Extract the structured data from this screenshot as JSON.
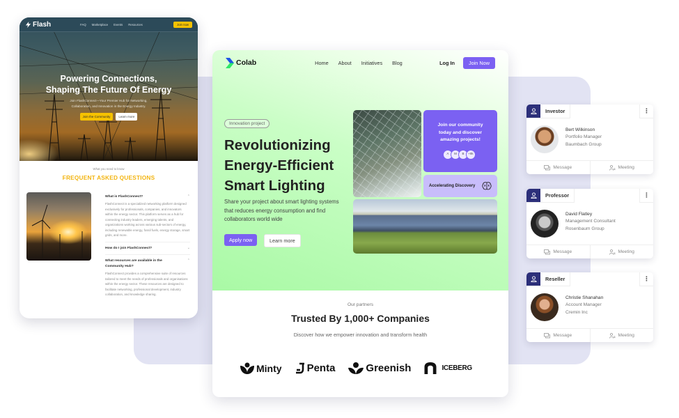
{
  "flash": {
    "brand": "Flash",
    "nav": [
      "FAQ",
      "Marketplace",
      "Events",
      "Resources"
    ],
    "join_label": "Join now",
    "hero_title_line1": "Powering Connections,",
    "hero_title_line2": "Shaping The Future Of Energy",
    "hero_sub_line1": "Join FlashConnect—Your Premier Hub for Networking,",
    "hero_sub_line2": "Collaboration, and Innovation in the Energy Industry.",
    "cta_primary": "Join the Community",
    "cta_secondary": "Learn more",
    "faq_kicker": "What you need to know",
    "faq_title": "FREQUENT ASKED QUESTIONS",
    "faqs": [
      {
        "question": "What is FlashConnect?",
        "answer": "FlashConnect is a specialized networking platform designed exclusively for professionals, companies, and innovators within the energy sector. This platform serves as a hub for connecting industry leaders, emerging talents, and organizations working across various sub-sectors of energy, including renewable energy, fossil fuels, energy storage, smart grids, and more.",
        "chevron": "^"
      },
      {
        "question": "How do I join FlashConnect?",
        "answer": "",
        "chevron": "v"
      },
      {
        "question": "What resources are available in the Community Hub?",
        "answer": "FlashConnect provides a comprehensive suite of resources tailored to meet the needs of professionals and organisations within the energy sector. These resources are designed to facilitate networking, professional development, industry collaboration, and knowledge sharing.",
        "chevron": "^"
      }
    ]
  },
  "colab": {
    "brand": "Colab",
    "nav": [
      "Home",
      "About",
      "Initiatives",
      "Blog"
    ],
    "login_label": "Log In",
    "join_label": "Join Now",
    "pill": "Innovation project",
    "hero_title_line1": "Revolutionizing",
    "hero_title_line2": "Energy-Efficient",
    "hero_title_line3": "Smart Lighting",
    "hero_sub": "Share your project about smart lighting systems that reduces energy consumption and find collaborators world wide",
    "apply_label": "Apply now",
    "learn_label": "Learn more",
    "community_text": "Join our community today and discover amazing projects!",
    "avatars": [
      "A",
      "M",
      "B",
      "+9k"
    ],
    "accelerating_label": "Accelerating Discovery",
    "partners_kicker": "Our partners",
    "partners_title": "Trusted By 1,000+ Companies",
    "partners_sub": "Discover how we empower innovation and transform health",
    "partner_logos": [
      "Minty",
      "Penta",
      "Greenish",
      "ICEBERG"
    ],
    "colors": {
      "accent": "#7b61f2",
      "accent_light": "#c8bdfb",
      "hero_green": "#a9f9a5"
    }
  },
  "contacts": [
    {
      "tag": "Investor",
      "name": "Bert Wilkinson",
      "role": "Portfolio Manager",
      "org": "Baumbach Group"
    },
    {
      "tag": "Professor",
      "name": "David Flatley",
      "role": "Management Consultant",
      "org": "Rosenbaum Group"
    },
    {
      "tag": "Reseller",
      "name": "Christie Shanahan",
      "role": "Account Manager",
      "org": "Cremin Inc"
    }
  ],
  "contact_actions": {
    "message": "Message",
    "meeting": "Meeting"
  },
  "colors": {
    "flash_yellow": "#f6c200",
    "tag_navy": "#2c2f7a",
    "background_panel": "#e2e3f3"
  }
}
